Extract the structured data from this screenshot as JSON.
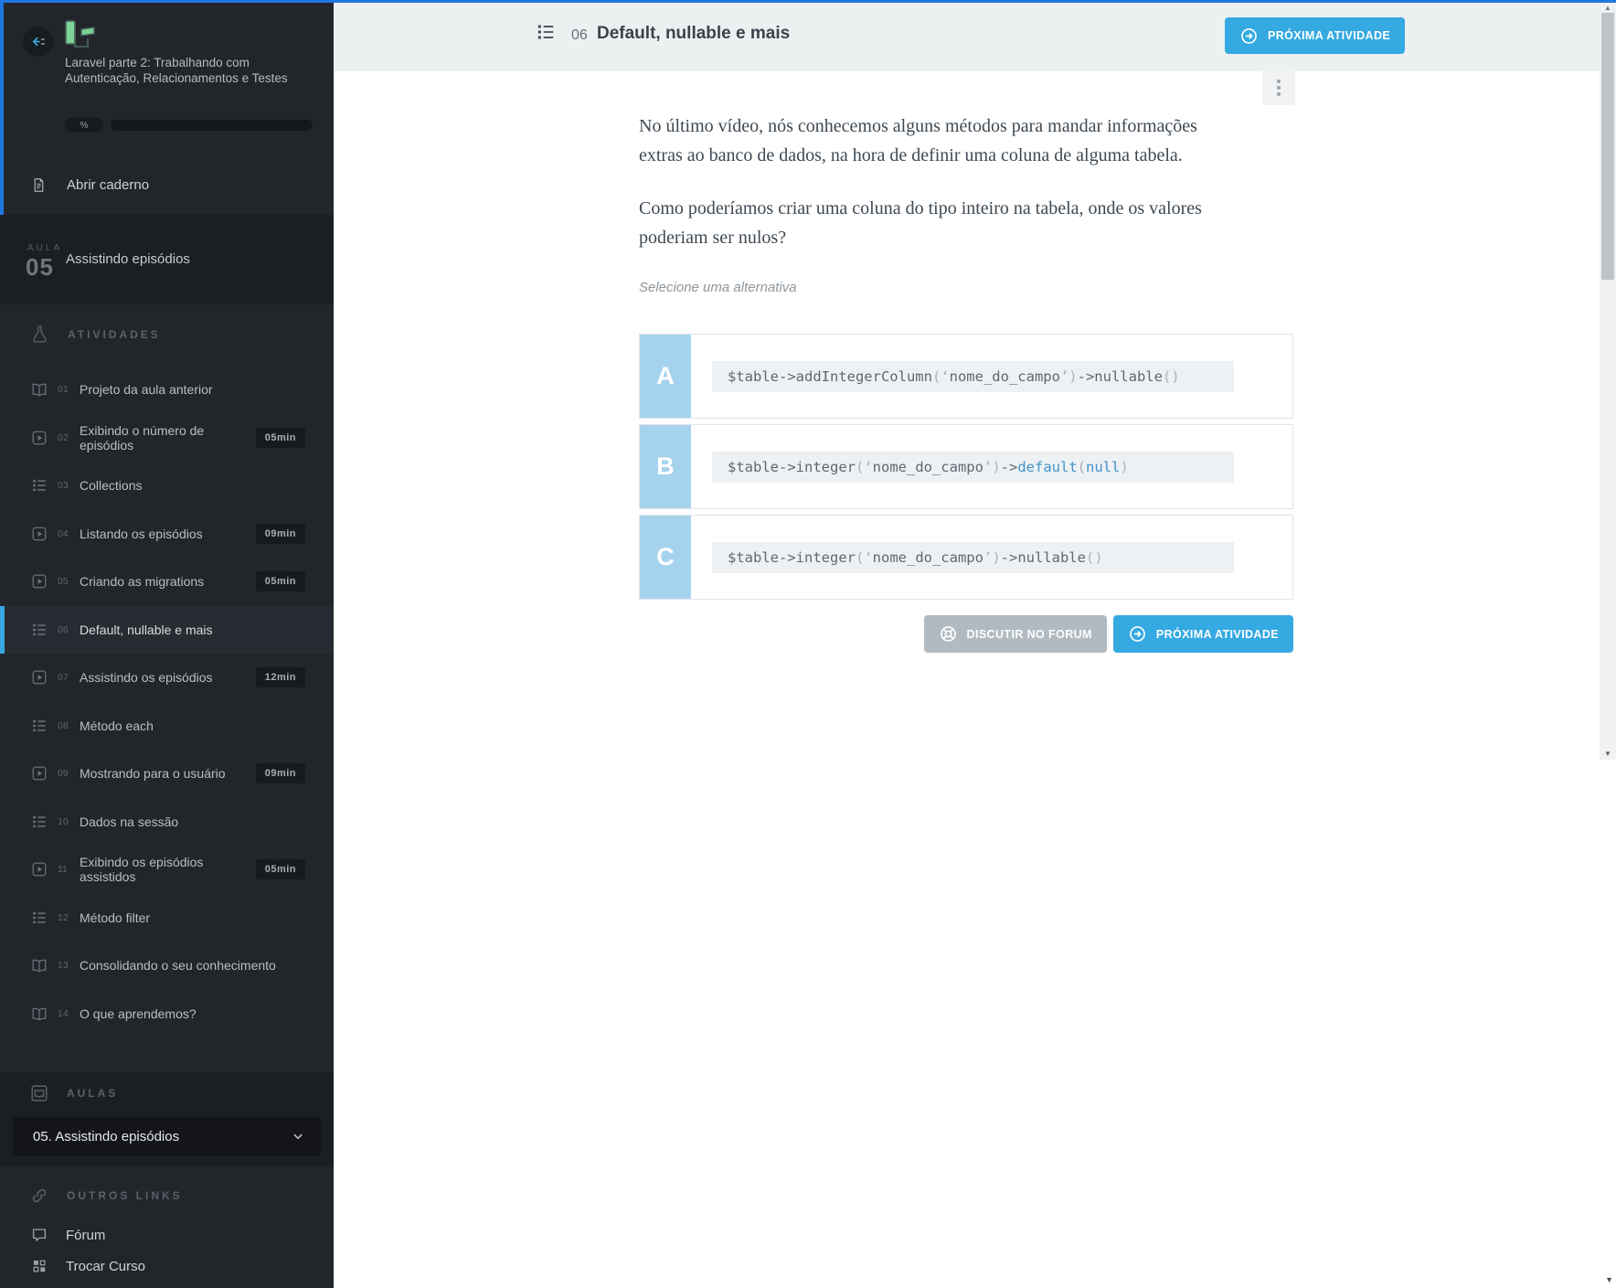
{
  "colors": {
    "accent_blue": "#35a9e1",
    "top_line_blue": "#1e76e0",
    "option_badge_blue": "#a5d3ee",
    "code_keyword_blue": "#4193c9",
    "sidebar_bg": "#22262b",
    "sidebar_block_bg": "#1b1f23",
    "header_bg": "#edf0f1",
    "gray_button": "#b1bac1"
  },
  "sidebar": {
    "course_title": "Laravel parte 2: Trabalhando com Autenticação, Relacionamentos e Testes",
    "progress_percent_label": "%",
    "open_notebook_label": "Abrir caderno",
    "lesson": {
      "kicker": "AULA",
      "number": "05",
      "title": "Assistindo episódios"
    },
    "activities_header": "ATIVIDADES",
    "activities": [
      {
        "num": "01",
        "label": "Projeto da aula anterior",
        "icon": "book"
      },
      {
        "num": "02",
        "label": "Exibindo o número de episódios",
        "icon": "video",
        "duration": "05min"
      },
      {
        "num": "03",
        "label": "Collections",
        "icon": "list"
      },
      {
        "num": "04",
        "label": "Listando os episódios",
        "icon": "video",
        "duration": "09min"
      },
      {
        "num": "05",
        "label": "Criando as migrations",
        "icon": "video",
        "duration": "05min"
      },
      {
        "num": "06",
        "label": "Default, nullable e mais",
        "icon": "list",
        "active": true
      },
      {
        "num": "07",
        "label": "Assistindo os episódios",
        "icon": "video",
        "duration": "12min"
      },
      {
        "num": "08",
        "label": "Método each",
        "icon": "list"
      },
      {
        "num": "09",
        "label": "Mostrando para o usuário",
        "icon": "video",
        "duration": "09min"
      },
      {
        "num": "10",
        "label": "Dados na sessão",
        "icon": "list"
      },
      {
        "num": "11",
        "label": "Exibindo os episódios assistidos",
        "icon": "video",
        "duration": "05min"
      },
      {
        "num": "12",
        "label": "Método filter",
        "icon": "list"
      },
      {
        "num": "13",
        "label": "Consolidando o seu conhecimento",
        "icon": "book"
      },
      {
        "num": "14",
        "label": "O que aprendemos?",
        "icon": "book"
      }
    ],
    "aulas_header": "AULAS",
    "aula_selector": {
      "value": "05. Assistindo episódios"
    },
    "outros_links_header": "OUTROS LINKS",
    "outros_links": [
      {
        "label": "Fórum",
        "icon": "forum"
      },
      {
        "label": "Trocar Curso",
        "icon": "grid"
      }
    ]
  },
  "content": {
    "header": {
      "activity_number": "06",
      "title": "Default, nullable e mais",
      "next_button_label": "PRÓXIMA ATIVIDADE"
    },
    "question": {
      "paragraph1": "No último vídeo, nós conhecemos alguns métodos para mandar informações extras ao banco de dados, na hora de definir uma coluna de alguma tabela.",
      "paragraph2": "Como poderíamos criar uma coluna do tipo inteiro na tabela, onde os valores poderiam ser nulos?",
      "hint": "Selecione uma alternativa",
      "options": [
        {
          "letter": "A",
          "code": "$table->addIntegerColumn(‘nome_do_campo’)->nullable()",
          "keywords": []
        },
        {
          "letter": "B",
          "code": "$table->integer(‘nome_do_campo’)->default(null)",
          "keywords": [
            "default",
            "null"
          ]
        },
        {
          "letter": "C",
          "code": "$table->integer(‘nome_do_campo’)->nullable()",
          "keywords": []
        }
      ],
      "forum_button_label": "DISCUTIR NO FORUM",
      "next_button_label": "PRÓXIMA ATIVIDADE"
    }
  }
}
